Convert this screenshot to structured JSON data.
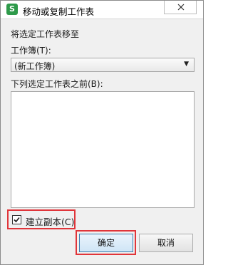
{
  "window": {
    "title": "移动或复制工作表",
    "app_icon_letter": "S",
    "close_icon": "close-icon"
  },
  "dialog": {
    "move_to_label": "将选定工作表移至",
    "workbook_label": "工作簿(T):",
    "workbook_selected": "(新工作簿)",
    "before_sheet_label": "下列选定工作表之前(B):",
    "before_sheet_items": [],
    "create_copy_label": "建立副本(C)",
    "create_copy_checked": true,
    "ok_label": "确定",
    "cancel_label": "取消"
  },
  "colors": {
    "highlight": "#e0353a",
    "app_icon": "#2e9a4a"
  }
}
